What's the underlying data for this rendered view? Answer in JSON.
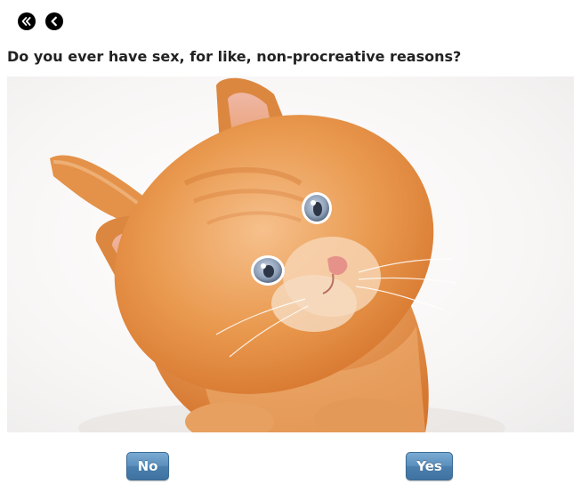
{
  "nav": {
    "back_all_icon": "double-chevron-left-icon",
    "back_icon": "chevron-left-icon"
  },
  "question": {
    "text": "Do you ever have sex, for like, non-procreative reasons?"
  },
  "image": {
    "subject": "orange kitten"
  },
  "answers": {
    "no_label": "No",
    "yes_label": "Yes",
    "button_color": "#4f86b5"
  }
}
